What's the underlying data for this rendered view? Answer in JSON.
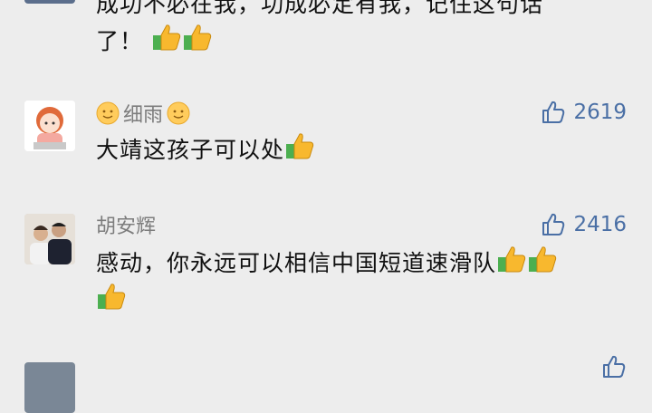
{
  "comments": [
    {
      "name": "",
      "text_line1": "成功不必在我，功成必定有我，记住这句话",
      "text_line2": "了！",
      "likes": ""
    },
    {
      "name": "细雨",
      "text": "大靖这孩子可以处",
      "likes": "2619"
    },
    {
      "name": "胡安辉",
      "text": "感动，你永远可以相信中国短道速滑队",
      "likes": "2416"
    }
  ],
  "icons": {
    "like": "thumbs-up-outline-icon",
    "thumb_emoji": "thumbs-up-emoji-icon",
    "smile_emoji": "smile-emoji-icon"
  },
  "colors": {
    "like": "#4a6fa5",
    "name": "#7d7d7d",
    "background": "#ededed"
  }
}
